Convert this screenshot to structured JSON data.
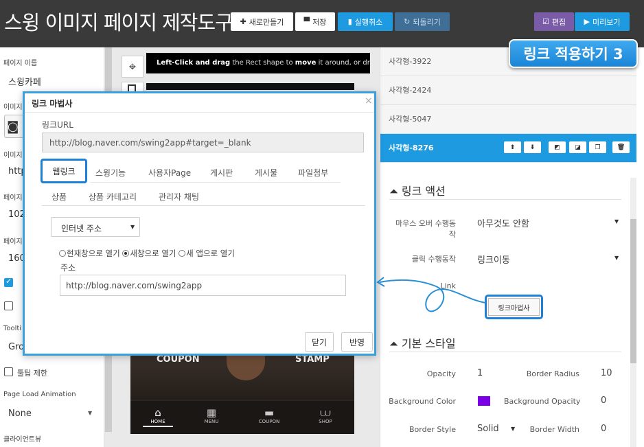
{
  "app": {
    "title": "스윙 이미지 페이지 제작도구"
  },
  "toolbar": {
    "new_label": "새로만들기",
    "save_label": "저장",
    "undo_label": "실행취소",
    "redo_label": "되돌리기",
    "edit_label": "편집",
    "preview_label": "미리보기"
  },
  "callout": {
    "text": "링크 적용하기 3"
  },
  "left_panel": {
    "page_name_label": "페이지 이름",
    "page_name_value": "스윙카페",
    "image_label_1": "이미지",
    "image_label_2": "이미지",
    "url_partial": "http",
    "page_label_1": "페이지",
    "value_1": "102",
    "page_label_2": "페이지",
    "value_2": "160",
    "tooltip_label": "Toolti",
    "tooltip_value": "Gro",
    "tooltip_limit_label": "툴팁 제한",
    "page_load_animation_label": "Page Load Animation",
    "page_load_animation_value": "None",
    "client_view_label": "클라이언트뷰"
  },
  "canvas": {
    "hint_bold": "Left-Click and drag",
    "hint_mid": " the Rect shape to ",
    "hint_move": "move",
    "hint_rest": " it around, or drag any of",
    "coupon_text": "COUPON",
    "stamp_text": "STAMP",
    "nav": [
      {
        "label": "HOME",
        "icon": "home-icon"
      },
      {
        "label": "MENU",
        "icon": "grid-icon"
      },
      {
        "label": "COUPON",
        "icon": "coupon-icon"
      },
      {
        "label": "SHOP",
        "icon": "basket-icon"
      }
    ]
  },
  "right_panel": {
    "shapes": [
      "사각형-3922",
      "사각형-2424",
      "사각형-5047",
      "사각형-8276"
    ],
    "link_section_title": "링크 액션",
    "mouseover_label_1": "마우스 오버 수행동",
    "mouseover_label_2": "작",
    "mouseover_value": "아무것도 안함",
    "click_label": "클릭 수행동작",
    "click_value": "링크이동",
    "link_label": "Link",
    "link_wizard_button": "링크마법사",
    "basic_style_title": "기본 스타일",
    "opacity_label": "Opacity",
    "opacity_value": "1",
    "border_radius_label": "Border Radius",
    "border_radius_value": "10",
    "bg_color_label": "Background Color",
    "bg_color": "#7b00e6",
    "bg_opacity_label": "Background Opacity",
    "bg_opacity_value": "0",
    "border_style_label": "Border Style",
    "border_style_value": "Solid",
    "border_width_label": "Border Width",
    "border_width_value": "0"
  },
  "modal": {
    "title": "링크 마법사",
    "close": "×",
    "url_label": "링크URL",
    "url_value": "http://blog.naver.com/swing2app#target=_blank",
    "tabs": [
      "웹링크",
      "스윙기능",
      "사용자Page",
      "게시판",
      "게시물",
      "파일첨부"
    ],
    "tabs2": [
      "상품",
      "상품 카테고리",
      "관리자 채팅"
    ],
    "type_select": "인터넷 주소",
    "radio_current": "현재창으로 열기",
    "radio_new": "새창으로 열기",
    "radio_app": "새 앱으로 열기",
    "address_label": "주소",
    "address_value": "http://blog.naver.com/swing2app",
    "close_button": "닫기",
    "apply_button": "반영"
  },
  "colors": {
    "accent": "#1e9ae0",
    "topbar": "#3a3a3a",
    "edit": "#7a5ba8",
    "highlight": "#3aa0dd"
  }
}
